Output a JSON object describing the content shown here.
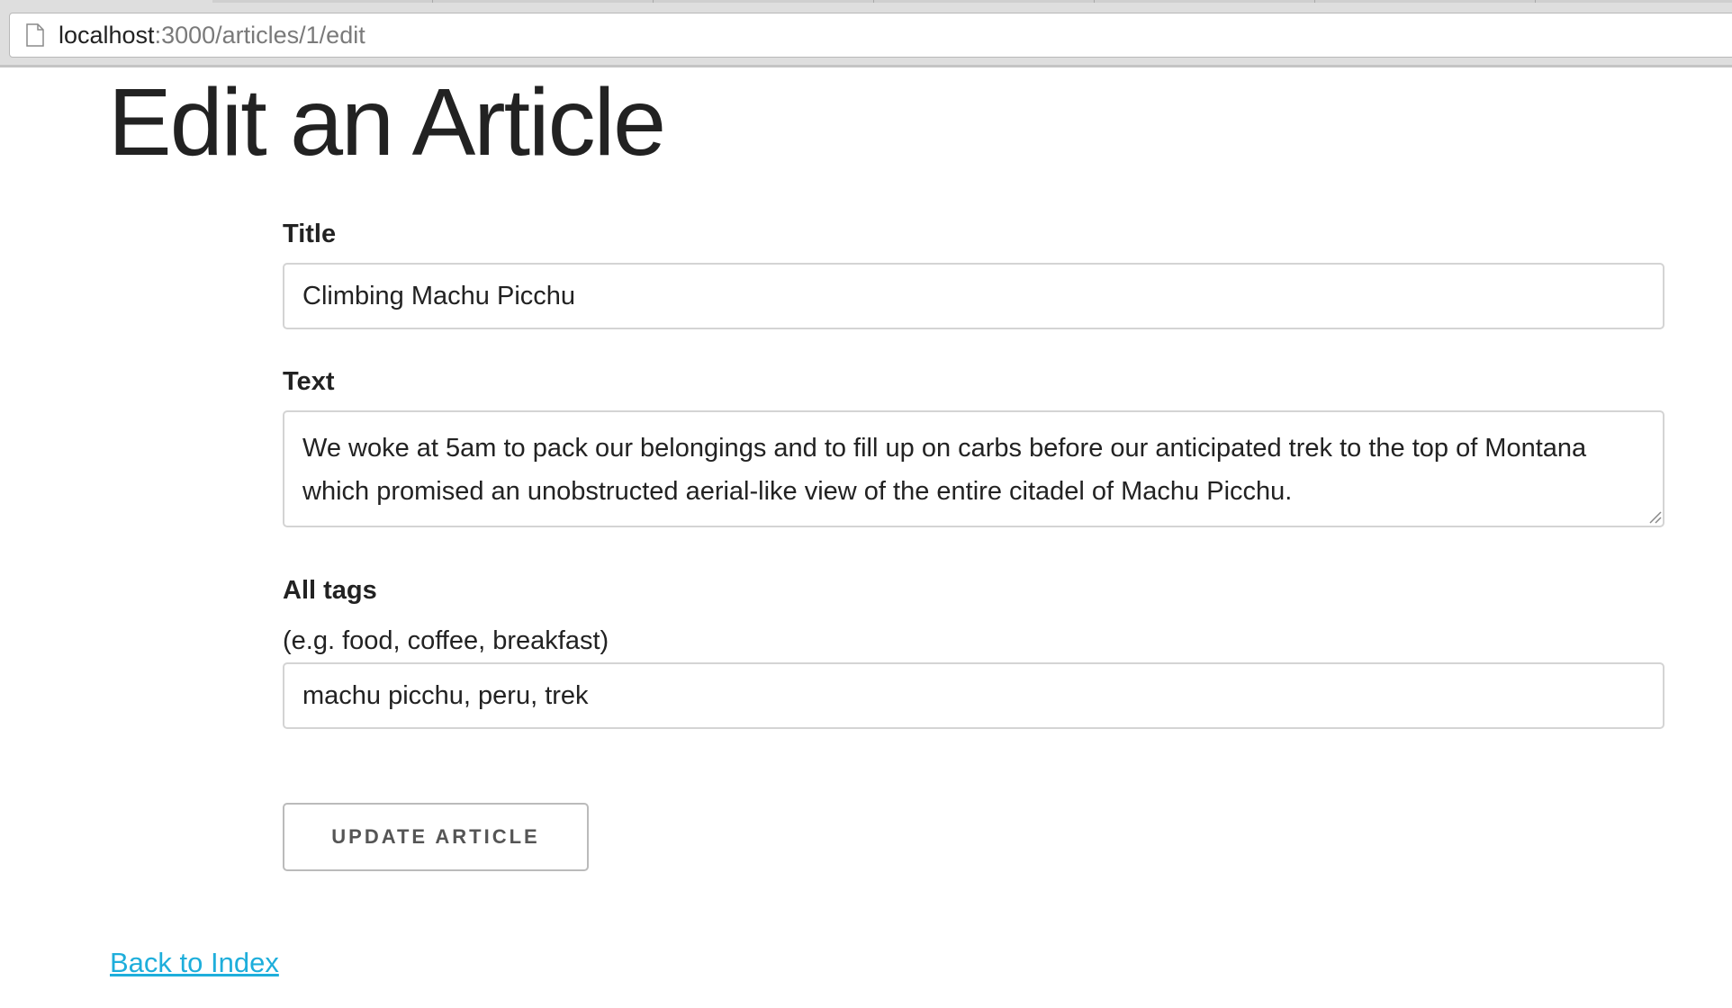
{
  "browser": {
    "url_host": "localhost",
    "url_path": ":3000/articles/1/edit"
  },
  "page": {
    "title": "Edit an Article"
  },
  "form": {
    "title_label": "Title",
    "title_value": "Climbing Machu Picchu",
    "text_label": "Text",
    "text_value": "We woke at 5am to pack our belongings and to fill up on carbs before our anticipated trek to the top of Montana which promised an unobstructed aerial-like view of the entire citadel of Machu Picchu.",
    "tags_label": "All tags",
    "tags_hint": "(e.g. food, coffee, breakfast)",
    "tags_value": "machu picchu, peru, trek",
    "submit_label": "UPDATE ARTICLE"
  },
  "footer": {
    "back_link": "Back to Index"
  }
}
